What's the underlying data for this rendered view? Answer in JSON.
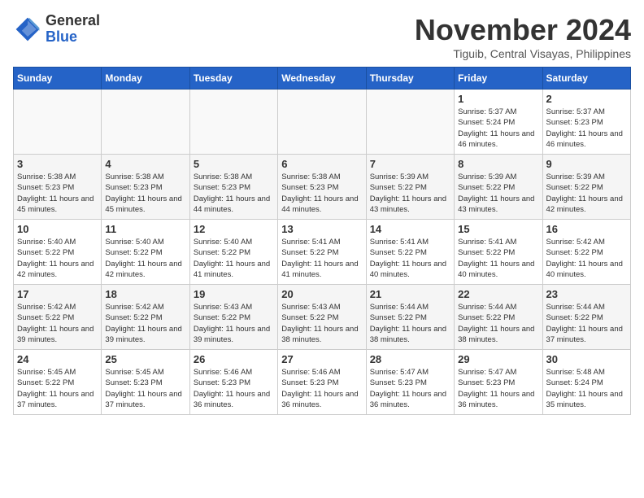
{
  "logo": {
    "general": "General",
    "blue": "Blue"
  },
  "title": "November 2024",
  "location": "Tiguib, Central Visayas, Philippines",
  "days_of_week": [
    "Sunday",
    "Monday",
    "Tuesday",
    "Wednesday",
    "Thursday",
    "Friday",
    "Saturday"
  ],
  "weeks": [
    [
      {
        "day": "",
        "info": ""
      },
      {
        "day": "",
        "info": ""
      },
      {
        "day": "",
        "info": ""
      },
      {
        "day": "",
        "info": ""
      },
      {
        "day": "",
        "info": ""
      },
      {
        "day": "1",
        "info": "Sunrise: 5:37 AM\nSunset: 5:24 PM\nDaylight: 11 hours and 46 minutes."
      },
      {
        "day": "2",
        "info": "Sunrise: 5:37 AM\nSunset: 5:23 PM\nDaylight: 11 hours and 46 minutes."
      }
    ],
    [
      {
        "day": "3",
        "info": "Sunrise: 5:38 AM\nSunset: 5:23 PM\nDaylight: 11 hours and 45 minutes."
      },
      {
        "day": "4",
        "info": "Sunrise: 5:38 AM\nSunset: 5:23 PM\nDaylight: 11 hours and 45 minutes."
      },
      {
        "day": "5",
        "info": "Sunrise: 5:38 AM\nSunset: 5:23 PM\nDaylight: 11 hours and 44 minutes."
      },
      {
        "day": "6",
        "info": "Sunrise: 5:38 AM\nSunset: 5:23 PM\nDaylight: 11 hours and 44 minutes."
      },
      {
        "day": "7",
        "info": "Sunrise: 5:39 AM\nSunset: 5:22 PM\nDaylight: 11 hours and 43 minutes."
      },
      {
        "day": "8",
        "info": "Sunrise: 5:39 AM\nSunset: 5:22 PM\nDaylight: 11 hours and 43 minutes."
      },
      {
        "day": "9",
        "info": "Sunrise: 5:39 AM\nSunset: 5:22 PM\nDaylight: 11 hours and 42 minutes."
      }
    ],
    [
      {
        "day": "10",
        "info": "Sunrise: 5:40 AM\nSunset: 5:22 PM\nDaylight: 11 hours and 42 minutes."
      },
      {
        "day": "11",
        "info": "Sunrise: 5:40 AM\nSunset: 5:22 PM\nDaylight: 11 hours and 42 minutes."
      },
      {
        "day": "12",
        "info": "Sunrise: 5:40 AM\nSunset: 5:22 PM\nDaylight: 11 hours and 41 minutes."
      },
      {
        "day": "13",
        "info": "Sunrise: 5:41 AM\nSunset: 5:22 PM\nDaylight: 11 hours and 41 minutes."
      },
      {
        "day": "14",
        "info": "Sunrise: 5:41 AM\nSunset: 5:22 PM\nDaylight: 11 hours and 40 minutes."
      },
      {
        "day": "15",
        "info": "Sunrise: 5:41 AM\nSunset: 5:22 PM\nDaylight: 11 hours and 40 minutes."
      },
      {
        "day": "16",
        "info": "Sunrise: 5:42 AM\nSunset: 5:22 PM\nDaylight: 11 hours and 40 minutes."
      }
    ],
    [
      {
        "day": "17",
        "info": "Sunrise: 5:42 AM\nSunset: 5:22 PM\nDaylight: 11 hours and 39 minutes."
      },
      {
        "day": "18",
        "info": "Sunrise: 5:42 AM\nSunset: 5:22 PM\nDaylight: 11 hours and 39 minutes."
      },
      {
        "day": "19",
        "info": "Sunrise: 5:43 AM\nSunset: 5:22 PM\nDaylight: 11 hours and 39 minutes."
      },
      {
        "day": "20",
        "info": "Sunrise: 5:43 AM\nSunset: 5:22 PM\nDaylight: 11 hours and 38 minutes."
      },
      {
        "day": "21",
        "info": "Sunrise: 5:44 AM\nSunset: 5:22 PM\nDaylight: 11 hours and 38 minutes."
      },
      {
        "day": "22",
        "info": "Sunrise: 5:44 AM\nSunset: 5:22 PM\nDaylight: 11 hours and 38 minutes."
      },
      {
        "day": "23",
        "info": "Sunrise: 5:44 AM\nSunset: 5:22 PM\nDaylight: 11 hours and 37 minutes."
      }
    ],
    [
      {
        "day": "24",
        "info": "Sunrise: 5:45 AM\nSunset: 5:22 PM\nDaylight: 11 hours and 37 minutes."
      },
      {
        "day": "25",
        "info": "Sunrise: 5:45 AM\nSunset: 5:23 PM\nDaylight: 11 hours and 37 minutes."
      },
      {
        "day": "26",
        "info": "Sunrise: 5:46 AM\nSunset: 5:23 PM\nDaylight: 11 hours and 36 minutes."
      },
      {
        "day": "27",
        "info": "Sunrise: 5:46 AM\nSunset: 5:23 PM\nDaylight: 11 hours and 36 minutes."
      },
      {
        "day": "28",
        "info": "Sunrise: 5:47 AM\nSunset: 5:23 PM\nDaylight: 11 hours and 36 minutes."
      },
      {
        "day": "29",
        "info": "Sunrise: 5:47 AM\nSunset: 5:23 PM\nDaylight: 11 hours and 36 minutes."
      },
      {
        "day": "30",
        "info": "Sunrise: 5:48 AM\nSunset: 5:24 PM\nDaylight: 11 hours and 35 minutes."
      }
    ]
  ]
}
